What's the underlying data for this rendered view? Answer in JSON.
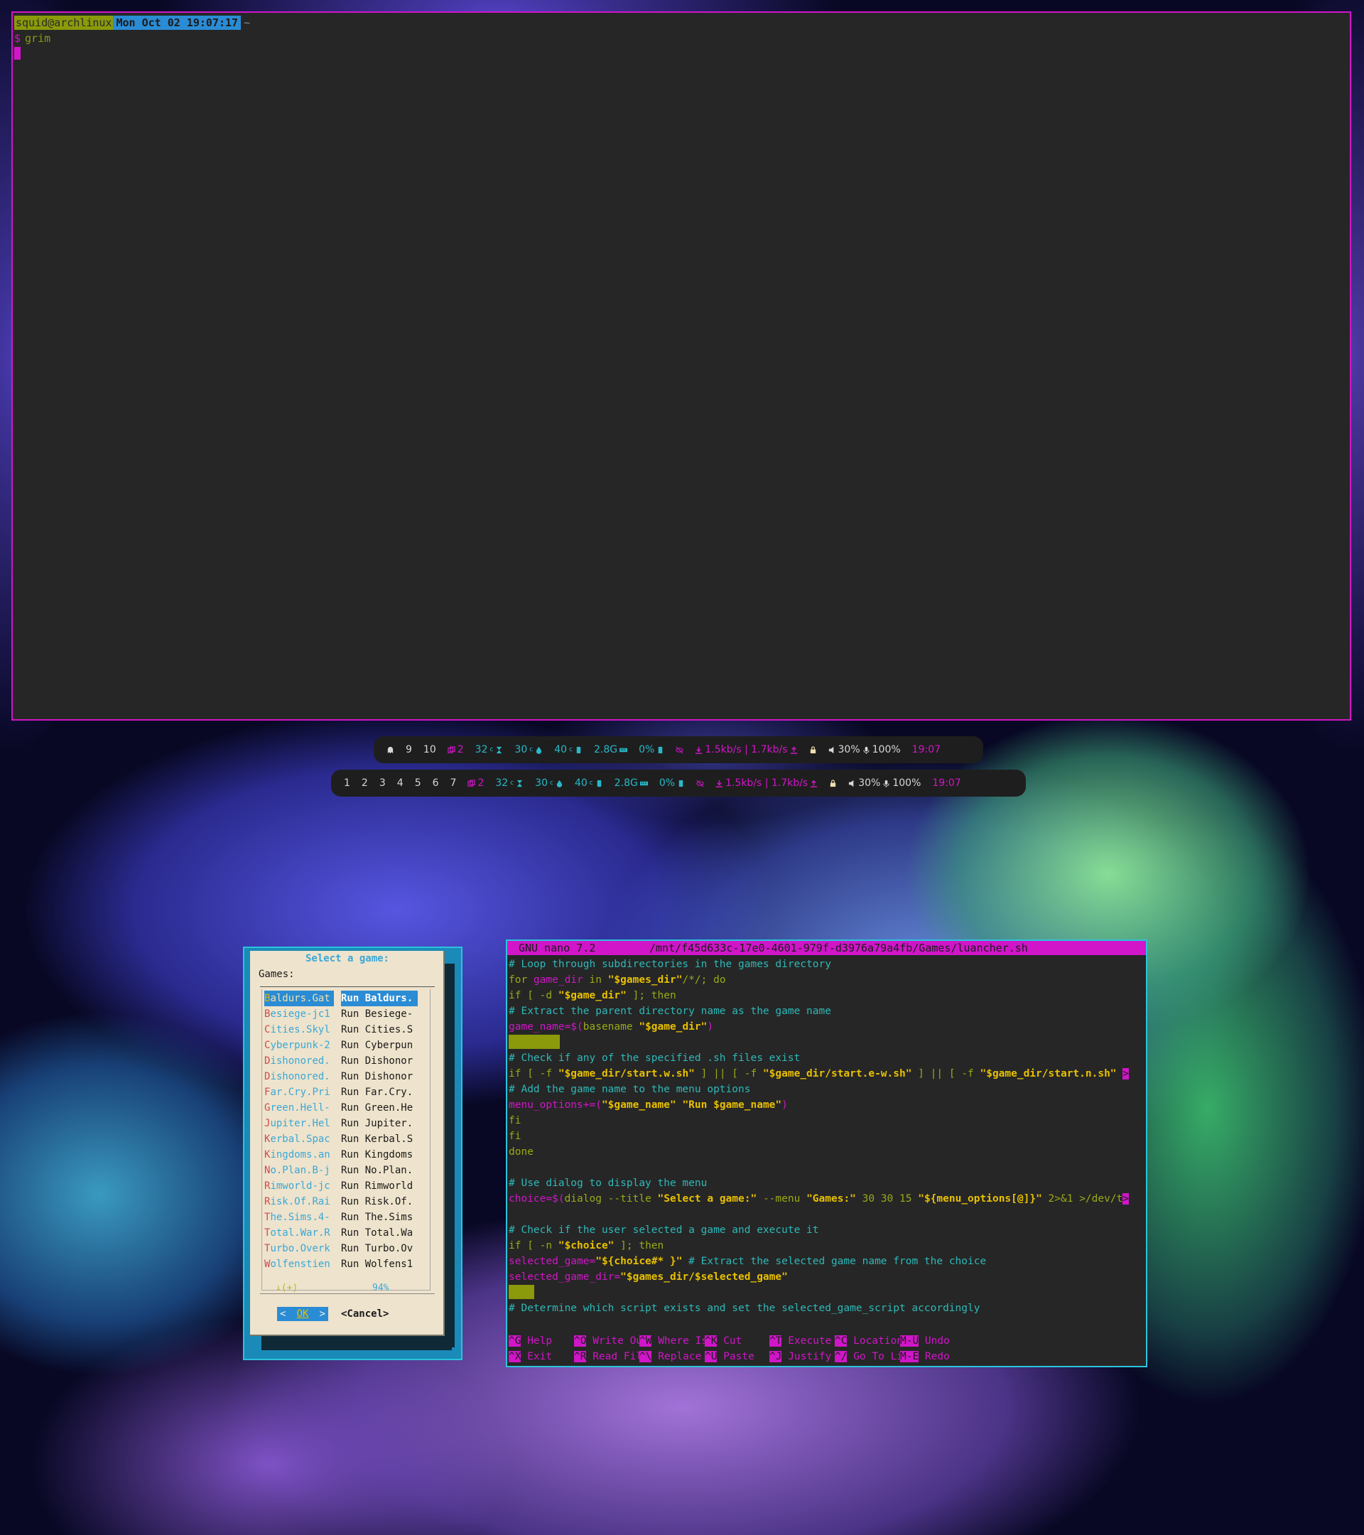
{
  "top_terminal": {
    "user_host": "squid@archlinux",
    "datetime": "Mon Oct 02 19:07:17",
    "cwd": "~",
    "prompt_symbol": "$",
    "command": "grim"
  },
  "bar_top": {
    "workspaces": [
      "9",
      "10"
    ],
    "windows": "2",
    "cpu_temp": "32",
    "temp2": "30",
    "temp3": "40",
    "memory": "2.8G",
    "disk": "0%",
    "net": "1.5kb/s | 1.7kb/s",
    "volume": "30%",
    "mic": "100%",
    "clock": "19:07"
  },
  "bar_bottom": {
    "workspaces": [
      "1",
      "2",
      "3",
      "4",
      "5",
      "6",
      "7"
    ],
    "windows": "2",
    "cpu_temp": "32",
    "temp2": "30",
    "temp3": "40",
    "memory": "2.8G",
    "disk": "0%",
    "net": "1.5kb/s | 1.7kb/s",
    "volume": "30%",
    "mic": "100%",
    "clock": "19:07"
  },
  "dialog": {
    "title": "Select a game:",
    "prompt": "Games:",
    "rows": [
      {
        "tag_first": "B",
        "tag_rest": "aldurs.Gat",
        "item": "Run Baldurs."
      },
      {
        "tag_first": "B",
        "tag_rest": "esiege-jc1",
        "item": "Run Besiege-"
      },
      {
        "tag_first": "C",
        "tag_rest": "ities.Skyl",
        "item": "Run Cities.S"
      },
      {
        "tag_first": "C",
        "tag_rest": "yberpunk-2",
        "item": "Run Cyberpun"
      },
      {
        "tag_first": "D",
        "tag_rest": "ishonored.",
        "item": "Run Dishonor"
      },
      {
        "tag_first": "D",
        "tag_rest": "ishonored.",
        "item": "Run Dishonor"
      },
      {
        "tag_first": "F",
        "tag_rest": "ar.Cry.Pri",
        "item": "Run Far.Cry."
      },
      {
        "tag_first": "G",
        "tag_rest": "reen.Hell-",
        "item": "Run Green.He"
      },
      {
        "tag_first": "J",
        "tag_rest": "upiter.Hel",
        "item": "Run Jupiter."
      },
      {
        "tag_first": "K",
        "tag_rest": "erbal.Spac",
        "item": "Run Kerbal.S"
      },
      {
        "tag_first": "K",
        "tag_rest": "ingdoms.an",
        "item": "Run Kingdoms"
      },
      {
        "tag_first": "N",
        "tag_rest": "o.Plan.B-j",
        "item": "Run No.Plan."
      },
      {
        "tag_first": "R",
        "tag_rest": "imworld-jc",
        "item": "Run Rimworld"
      },
      {
        "tag_first": "R",
        "tag_rest": "isk.Of.Rai",
        "item": "Run Risk.Of."
      },
      {
        "tag_first": "T",
        "tag_rest": "he.Sims.4-",
        "item": "Run The.Sims"
      },
      {
        "tag_first": "T",
        "tag_rest": "otal.War.R",
        "item": "Run Total.Wa"
      },
      {
        "tag_first": "T",
        "tag_rest": "urbo.Overk",
        "item": "Run Turbo.Ov"
      },
      {
        "tag_first": "W",
        "tag_rest": "olfenstien",
        "item": "Run Wolfens1"
      }
    ],
    "scroll_indicator": "↓(+)",
    "percent": "94%",
    "ok_left": "<",
    "ok_label": "OK",
    "ok_right": ">",
    "cancel_label": "<Cancel>"
  },
  "nano": {
    "version": "GNU nano 7.2",
    "path": "/mnt/f45d633c-17e0-4601-979f-d3976a79a4fb/Games/luancher.sh",
    "lines": [
      [
        {
          "c": "cm",
          "t": "# Loop through subdirectories in the games directory"
        }
      ],
      [
        {
          "c": "kw",
          "t": "for "
        },
        {
          "c": "mg",
          "t": "game_dir"
        },
        {
          "c": "kw",
          "t": " in "
        },
        {
          "c": "st",
          "t": "\"$games_dir\""
        },
        {
          "c": "kw",
          "t": "/*/; do"
        }
      ],
      [
        {
          "c": "kw",
          "t": "if [ -d "
        },
        {
          "c": "st",
          "t": "\"$game_dir\""
        },
        {
          "c": "kw",
          "t": " ]; then"
        }
      ],
      [
        {
          "c": "cm",
          "t": "# Extract the parent directory name as the game name"
        }
      ],
      [
        {
          "c": "mg",
          "t": "game_name=$("
        },
        {
          "c": "kw",
          "t": "basename "
        },
        {
          "c": "st",
          "t": "\"$game_dir\""
        },
        {
          "c": "mg",
          "t": ")"
        }
      ],
      [
        {
          "c": "ws",
          "t": "        "
        }
      ],
      [
        {
          "c": "cm",
          "t": "# Check if any of the specified .sh files exist"
        }
      ],
      [
        {
          "c": "kw",
          "t": "if [ -f "
        },
        {
          "c": "st",
          "t": "\"$game_dir/start.w.sh\""
        },
        {
          "c": "kw",
          "t": " ] || [ -f "
        },
        {
          "c": "st",
          "t": "\"$game_dir/start.e-w.sh\""
        },
        {
          "c": "kw",
          "t": " ] || [ -f "
        },
        {
          "c": "st",
          "t": "\"$game_dir/start.n.sh\""
        },
        {
          "c": "kw",
          "t": " "
        },
        {
          "c": "tr",
          "t": ">"
        }
      ],
      [
        {
          "c": "cm",
          "t": "# Add the game name to the menu options"
        }
      ],
      [
        {
          "c": "mg",
          "t": "menu_options+=("
        },
        {
          "c": "st",
          "t": "\"$game_name\""
        },
        {
          "c": "kw",
          "t": " "
        },
        {
          "c": "st",
          "t": "\"Run $game_name\""
        },
        {
          "c": "mg",
          "t": ")"
        }
      ],
      [
        {
          "c": "kw",
          "t": "fi"
        }
      ],
      [
        {
          "c": "kw",
          "t": "fi"
        }
      ],
      [
        {
          "c": "kw",
          "t": "done"
        }
      ],
      [
        {
          "c": "gy",
          "t": ""
        }
      ],
      [
        {
          "c": "cm",
          "t": "# Use dialog to display the menu"
        }
      ],
      [
        {
          "c": "mg",
          "t": "choice=$("
        },
        {
          "c": "kw",
          "t": "dialog --title "
        },
        {
          "c": "st",
          "t": "\"Select a game:\""
        },
        {
          "c": "kw",
          "t": " --menu "
        },
        {
          "c": "st",
          "t": "\"Games:\""
        },
        {
          "c": "kw",
          "t": " 30 30 15 "
        },
        {
          "c": "st",
          "t": "\"${menu_options[@]}\""
        },
        {
          "c": "kw",
          "t": " 2>&1 >/dev/t"
        },
        {
          "c": "tr",
          "t": ">"
        }
      ],
      [
        {
          "c": "gy",
          "t": ""
        }
      ],
      [
        {
          "c": "cm",
          "t": "# Check if the user selected a game and execute it"
        }
      ],
      [
        {
          "c": "kw",
          "t": "if [ -n "
        },
        {
          "c": "st",
          "t": "\"$choice\""
        },
        {
          "c": "kw",
          "t": " ]; then"
        }
      ],
      [
        {
          "c": "mg",
          "t": "selected_game="
        },
        {
          "c": "st",
          "t": "\"${choice#* }\""
        },
        {
          "c": "kw",
          "t": " "
        },
        {
          "c": "cm",
          "t": "# Extract the selected game name from the choice"
        }
      ],
      [
        {
          "c": "mg",
          "t": "selected_game_dir="
        },
        {
          "c": "st",
          "t": "\"$games_dir/$selected_game\""
        }
      ],
      [
        {
          "c": "ws",
          "t": "    "
        }
      ],
      [
        {
          "c": "cm",
          "t": "# Determine which script exists and set the selected_game_script accordingly"
        }
      ]
    ],
    "shortcuts": [
      [
        {
          "k": "^G",
          "t": "Help"
        },
        {
          "k": "^O",
          "t": "Write Out"
        },
        {
          "k": "^W",
          "t": "Where Is"
        },
        {
          "k": "^K",
          "t": "Cut"
        },
        {
          "k": "^T",
          "t": "Execute"
        },
        {
          "k": "^C",
          "t": "Location"
        },
        {
          "k": "M-U",
          "t": "Undo"
        }
      ],
      [
        {
          "k": "^X",
          "t": "Exit"
        },
        {
          "k": "^R",
          "t": "Read File"
        },
        {
          "k": "^\\",
          "t": "Replace"
        },
        {
          "k": "^U",
          "t": "Paste"
        },
        {
          "k": "^J",
          "t": "Justify"
        },
        {
          "k": "^/",
          "t": "Go To Line"
        },
        {
          "k": "M-E",
          "t": "Redo"
        }
      ]
    ]
  }
}
